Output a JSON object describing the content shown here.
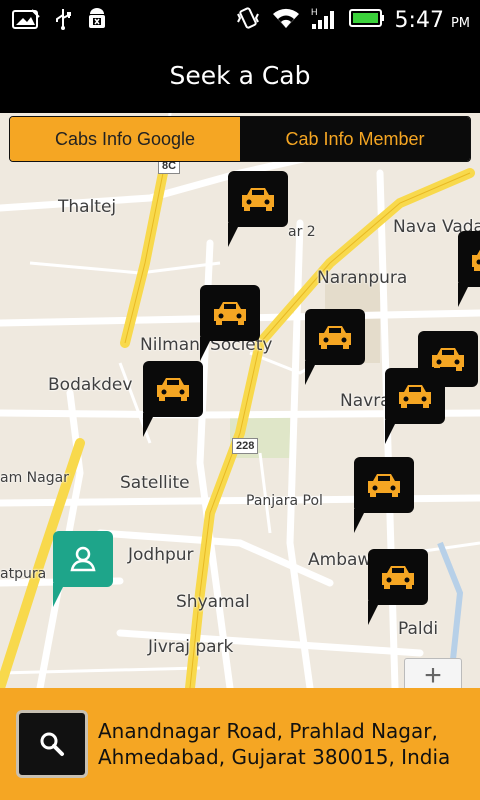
{
  "status_bar": {
    "time": "5:47",
    "ampm": "PM",
    "icons": [
      "image-icon",
      "usb-icon",
      "android-debug-icon",
      "vibrate-icon",
      "wifi-icon",
      "signal-icon",
      "battery-icon"
    ]
  },
  "header": {
    "title": "Seek a Cab"
  },
  "tabs": [
    {
      "label": "Cabs Info Google",
      "active": true
    },
    {
      "label": "Cab Info Member",
      "active": false
    }
  ],
  "map": {
    "places": [
      "Thaltej",
      "Nava Vada",
      "Naranpura",
      "Nilmani Society",
      "Bodakdev",
      "Navra",
      "am Nagar",
      "Satellite",
      "Panjara Pol",
      "Jodhpur",
      "Ambawadi",
      "atpura",
      "Shyamal",
      "Jivraj park",
      "Paldi"
    ],
    "road_shields": [
      "8C",
      "228"
    ],
    "sector_label": "ar 2",
    "marker_icon": "taxi-icon",
    "user_marker_icon": "person-pin-icon",
    "zoom_label": "+"
  },
  "footer": {
    "search_icon": "search-icon",
    "address_line1": "Anandnagar Road, Prahlad Nagar,",
    "address_line2": "Ahmedabad, Gujarat 380015, India"
  },
  "colors": {
    "accent": "#f5a623",
    "user": "#1ea58a",
    "map_bg": "#efe9df",
    "road_yellow": "#f8d94c"
  }
}
